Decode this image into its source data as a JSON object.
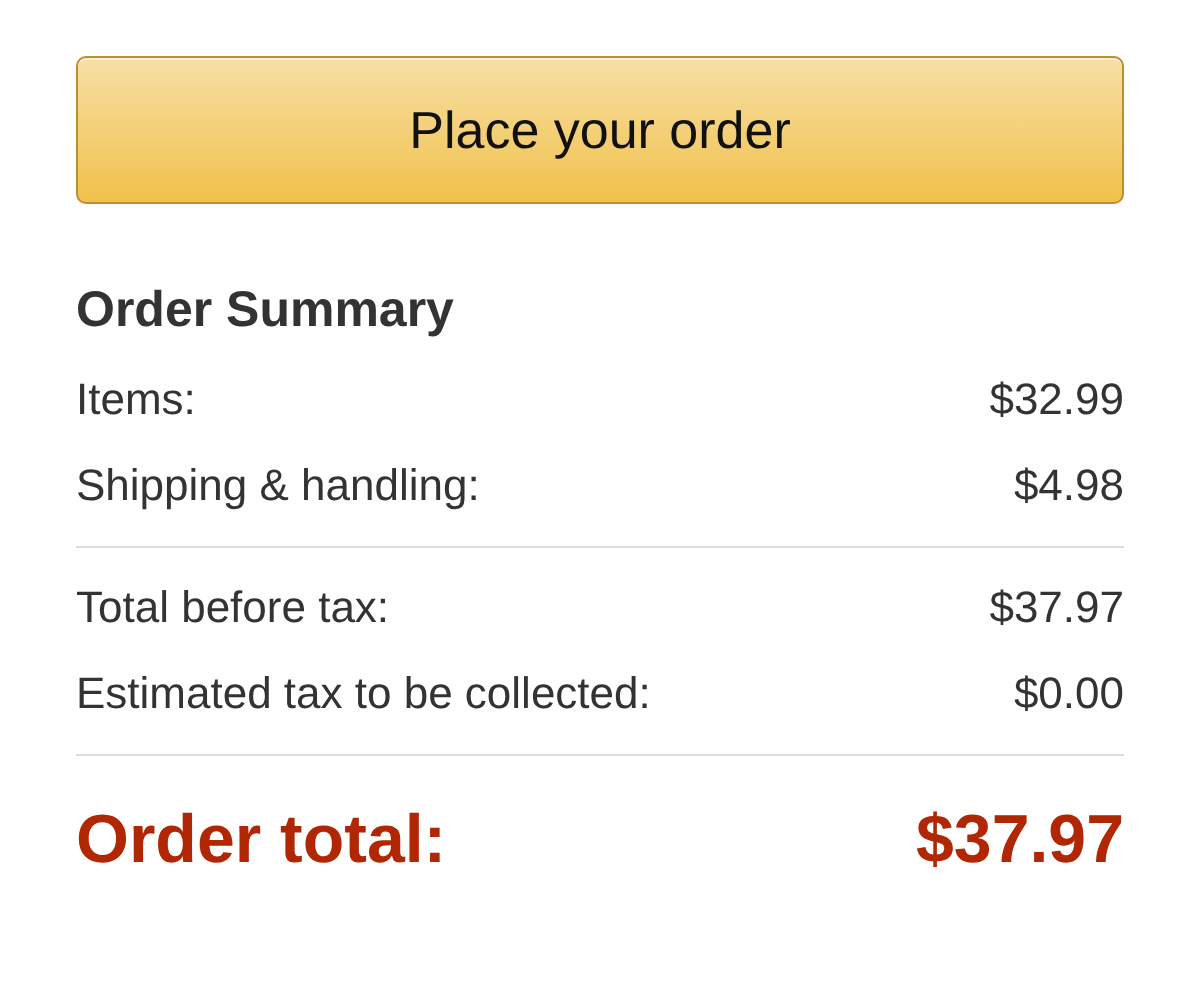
{
  "button": {
    "label": "Place your order"
  },
  "summary": {
    "title": "Order Summary",
    "groups": [
      [
        {
          "label": "Items:",
          "value": "$32.99"
        },
        {
          "label": "Shipping & handling:",
          "value": "$4.98"
        }
      ],
      [
        {
          "label": "Total before tax:",
          "value": "$37.97"
        },
        {
          "label": "Estimated tax to be collected:",
          "value": "$0.00"
        }
      ]
    ],
    "total": {
      "label": "Order total:",
      "value": "$37.97"
    }
  }
}
